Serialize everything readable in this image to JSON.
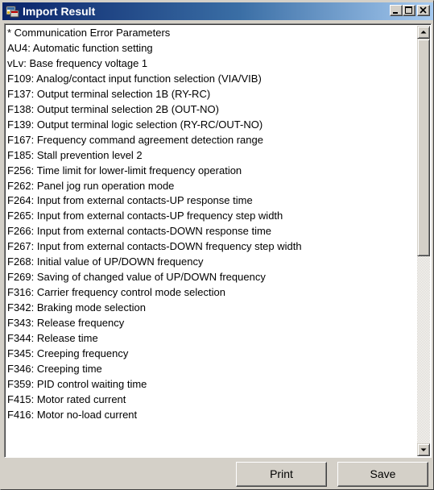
{
  "window": {
    "title": "Import Result",
    "title_bar_color": "#0a246a",
    "face_color": "#d4d0c8"
  },
  "icons": {
    "app": "app-icon",
    "minimize": "minimize-icon",
    "maximize": "maximize-icon",
    "close": "close-icon",
    "scroll_up": "arrow-up-icon",
    "scroll_down": "arrow-down-icon"
  },
  "list": {
    "items": [
      "* Communication Error Parameters",
      "AU4: Automatic function setting",
      "vLv: Base frequency voltage 1",
      "F109: Analog/contact input function selection (VIA/VIB)",
      "F137: Output terminal selection 1B (RY-RC)",
      "F138: Output terminal selection 2B (OUT-NO)",
      "F139: Output terminal logic selection (RY-RC/OUT-NO)",
      "F167: Frequency command agreement detection range",
      "F185: Stall prevention level 2",
      "F256: Time limit for lower-limit frequency operation",
      "F262: Panel jog run operation mode",
      "F264: Input from external contacts-UP response time",
      "F265: Input from external contacts-UP frequency step width",
      "F266: Input from external contacts-DOWN response time",
      "F267: Input from external contacts-DOWN frequency step width",
      "F268: Initial value of UP/DOWN frequency",
      "F269: Saving of changed value of UP/DOWN frequency",
      "F316: Carrier frequency control mode selection",
      "F342: Braking mode selection",
      "F343: Release frequency",
      "F344: Release time",
      "F345: Creeping frequency",
      "F346: Creeping time",
      "F359: PID control waiting time",
      "F415: Motor rated current",
      "F416: Motor no-load current"
    ]
  },
  "buttons": {
    "print": "Print",
    "save": "Save"
  }
}
